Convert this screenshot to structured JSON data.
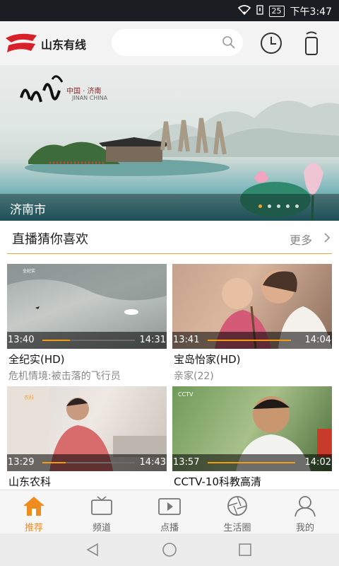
{
  "status_bar": {
    "time": "下午3:47",
    "battery": "25"
  },
  "header": {
    "brand": "山东有线"
  },
  "banner": {
    "artwork_title": "山水圣城",
    "artwork_subtitle": "中国 · 济南",
    "artwork_subtitle_en": "JINAN CHINA",
    "caption": "济南市",
    "slides": 5,
    "active_slide": 0
  },
  "section": {
    "title": "直播猜你喜欢",
    "more": "更多"
  },
  "channels": [
    {
      "start": "13:40",
      "end": "14:31",
      "title": "全纪实(HD)",
      "desc": "危机情境:被击落的飞行员",
      "progress": 0.3
    },
    {
      "start": "13:41",
      "end": "14:04",
      "title": "宝岛怡家(HD)",
      "desc": "亲家(22)",
      "progress": 0.9
    },
    {
      "start": "13:29",
      "end": "14:43",
      "title": "山东农科",
      "desc": "",
      "progress": 0.25
    },
    {
      "start": "13:57",
      "end": "14:02",
      "title": "CCTV-10科教高清",
      "desc": "",
      "progress": 0.95
    }
  ],
  "tabs": [
    {
      "label": "推荐",
      "icon": "home-icon"
    },
    {
      "label": "频道",
      "icon": "tv-icon"
    },
    {
      "label": "点播",
      "icon": "play-icon"
    },
    {
      "label": "生活圈",
      "icon": "aperture-icon"
    },
    {
      "label": "我的",
      "icon": "user-icon"
    }
  ],
  "active_tab": 0,
  "colors": {
    "accent": "#f08c1e",
    "brand_red": "#d8202a"
  }
}
